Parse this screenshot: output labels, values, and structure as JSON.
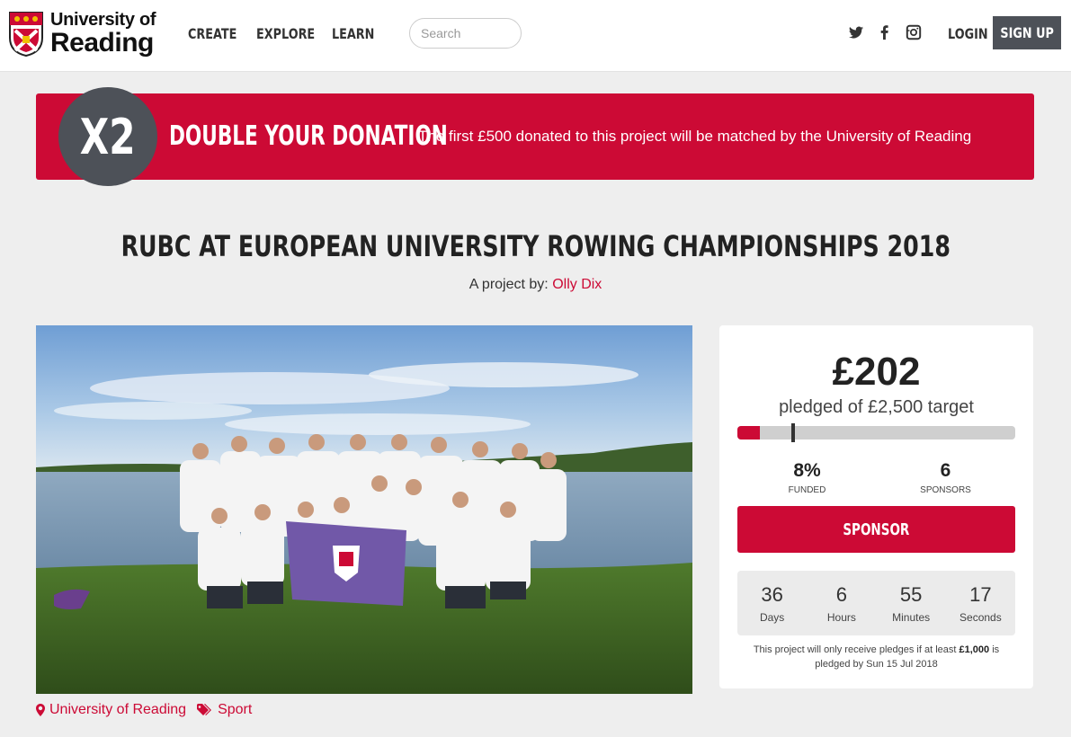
{
  "header": {
    "logo_line1": "University of",
    "logo_line2": "Reading",
    "nav": [
      "CREATE",
      "EXPLORE",
      "LEARN"
    ],
    "search_placeholder": "Search",
    "social": [
      "twitter-icon",
      "facebook-icon",
      "instagram-icon"
    ],
    "login_label": "LOGIN",
    "signup_label": "SIGN UP"
  },
  "banner": {
    "badge": "X2",
    "title": "DOUBLE YOUR DONATION",
    "text": "The first £500 donated to this project will be matched by the University of Reading",
    "color": "#cc0a35"
  },
  "project": {
    "title": "RUBC AT EUROPEAN UNIVERSITY ROWING CHAMPIONSHIPS 2018",
    "byline_prefix": "A project by:",
    "author": "Olly Dix",
    "tags": [
      {
        "icon": "map-marker-icon",
        "label": "University of Reading"
      },
      {
        "icon": "tag-icon",
        "label": "Sport"
      }
    ]
  },
  "funding": {
    "amount": "£202",
    "target_text": "pledged of £2,500 target",
    "progress_fraction": 0.08,
    "match_marker_fraction": 0.2,
    "funded_value": "8%",
    "funded_label": "FUNDED",
    "sponsors_value": "6",
    "sponsors_label": "SPONSORS",
    "sponsor_button": "SPONSOR",
    "countdown": [
      {
        "value": "36",
        "unit": "Days"
      },
      {
        "value": "6",
        "unit": "Hours"
      },
      {
        "value": "55",
        "unit": "Minutes"
      },
      {
        "value": "17",
        "unit": "Seconds"
      }
    ],
    "note_before": "This project will only receive pledges if at least",
    "note_amount": "£1,000",
    "note_after": "is pledged by Sun 15 Jul 2018"
  }
}
